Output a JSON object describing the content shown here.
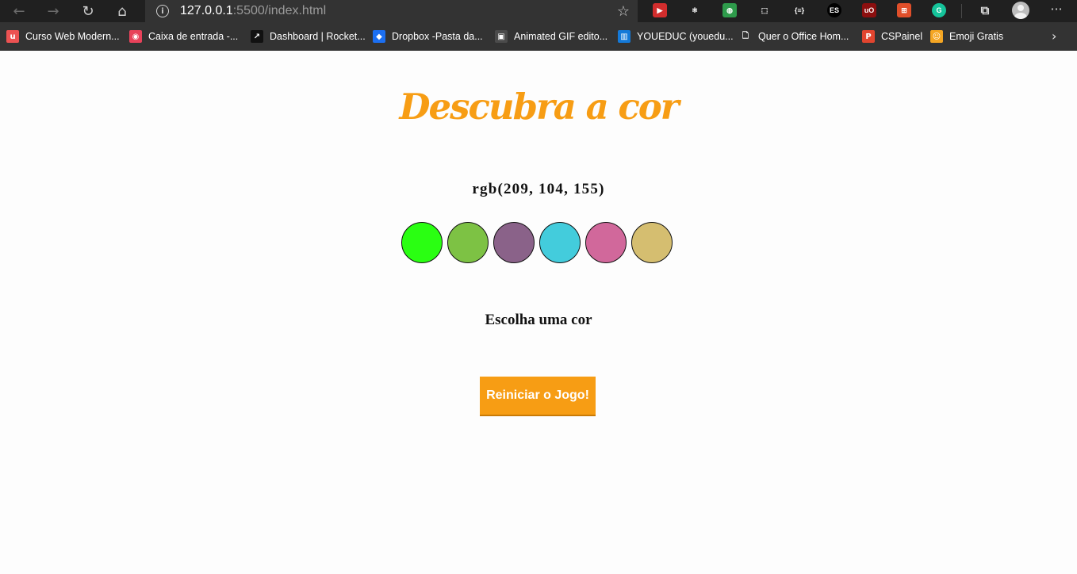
{
  "browser": {
    "url_host": "127.0.0.1",
    "url_rest": ":5500/index.html",
    "bookmarks": [
      {
        "label": "Curso Web Modern...",
        "icon": "udemy-icon",
        "color": "#ec5252",
        "glyph": "u"
      },
      {
        "label": "Caixa de entrada -...",
        "icon": "mail-icon",
        "color": "#e8425a",
        "glyph": "◉"
      },
      {
        "label": "Dashboard | Rocket...",
        "icon": "rocketseat-icon",
        "color": "#111111",
        "glyph": "↗"
      },
      {
        "label": "Dropbox -Pasta da...",
        "icon": "dropbox-icon",
        "color": "#1b6ff2",
        "glyph": "◆"
      },
      {
        "label": "Animated GIF edito...",
        "icon": "gif-editor-icon",
        "color": "#4b4b4b",
        "glyph": "▣"
      },
      {
        "label": "YOUEDUC (youedu...",
        "icon": "trello-icon",
        "color": "#1479d8",
        "glyph": "▥"
      },
      {
        "label": "Quer o Office Hom...",
        "icon": "document-icon",
        "color": "#333333",
        "glyph": "🗋"
      },
      {
        "label": "CSPainel",
        "icon": "cspainel-icon",
        "color": "#e2452f",
        "glyph": "P"
      },
      {
        "label": "Emoji Gratis",
        "icon": "emoji-icon",
        "color": "#f5a623",
        "glyph": "☺"
      }
    ],
    "extensions": [
      {
        "name": "ext-red-icon",
        "color": "#d22d2d",
        "glyph": "▶"
      },
      {
        "name": "react-devtools-icon",
        "color": "#202020",
        "glyph": "⚛"
      },
      {
        "name": "colorful-extension-icon",
        "color": "#2e9b4b",
        "glyph": "◍"
      },
      {
        "name": "screenshot-extension-icon",
        "color": "#202020",
        "glyph": "⬚"
      },
      {
        "name": "json-viewer-icon",
        "color": "#202020",
        "glyph": "{≡}"
      },
      {
        "name": "es-extension-icon",
        "color": "#000000",
        "glyph": "ES"
      },
      {
        "name": "ublock-icon",
        "color": "#8b0f0f",
        "glyph": "uO"
      },
      {
        "name": "sitemap-extension-icon",
        "color": "#e04f2a",
        "glyph": "⊞"
      },
      {
        "name": "grammarly-icon",
        "color": "#15c39a",
        "glyph": "G"
      }
    ]
  },
  "page": {
    "title": "Descubra a cor",
    "rgb_text": "rgb(209, 104, 155)",
    "circles": [
      "#2aff12",
      "#7dc244",
      "#8a6289",
      "#43ccdc",
      "#d1689b",
      "#d5be70"
    ],
    "message": "Escolha uma cor",
    "reset_label": "Reiniciar o Jogo!"
  }
}
